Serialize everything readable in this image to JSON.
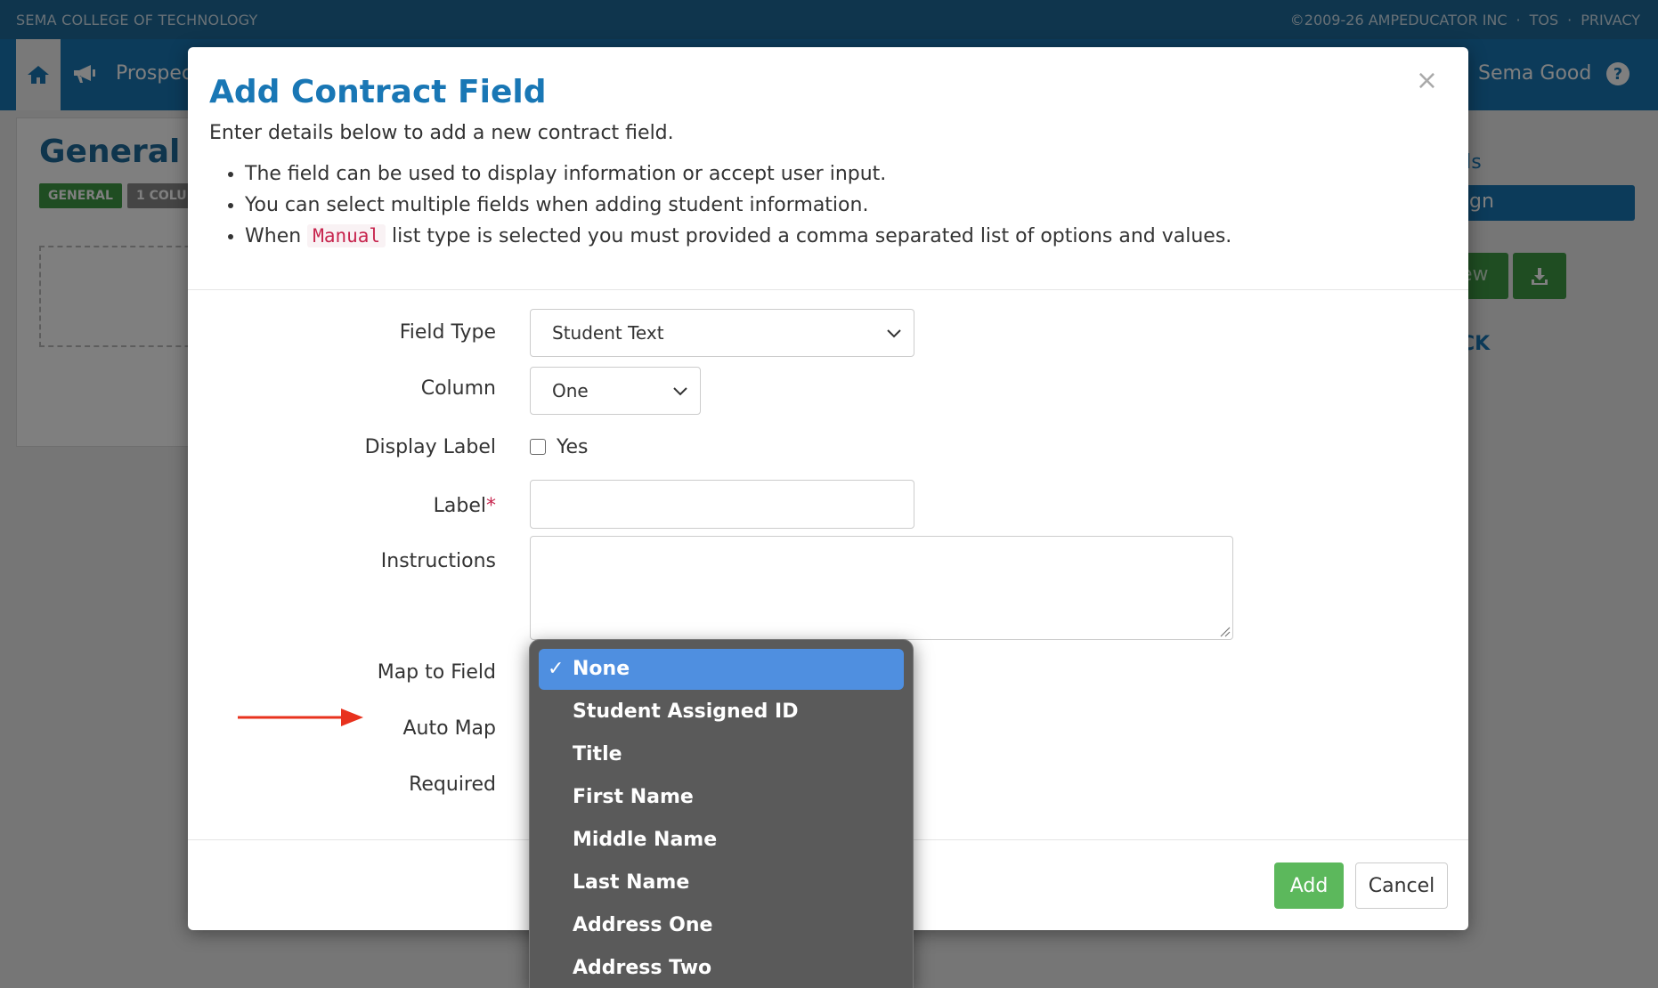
{
  "topbar": {
    "school": "SEMA COLLEGE OF TECHNOLOGY",
    "links": [
      "©2009-26 AMPEDUCATOR INC",
      "·",
      "TOS",
      "·",
      "PRIVACY"
    ]
  },
  "navbar": {
    "prospect": "Prospec",
    "user": "Sema Good"
  },
  "page": {
    "title": "General Se",
    "badge_general": "GENERAL",
    "badge_column": "1 COLU",
    "right_link1": "ils",
    "right_bar": "gn",
    "right_green1": "ew",
    "right_link2": "CK"
  },
  "modal": {
    "title": "Add Contract Field",
    "subtitle": "Enter details below to add a new contract field.",
    "bullets": {
      "b1": "The field can be used to display information or accept user input.",
      "b2": "You can select multiple fields when adding student information.",
      "b3_pre": "When",
      "b3_code": "Manual",
      "b3_post": "list type is selected you must provided a comma separated list of options and values."
    },
    "close_glyph": "×",
    "labels": {
      "field_type": "Field Type",
      "column": "Column",
      "display_label": "Display Label",
      "label": "Label",
      "label_required": "*",
      "instructions": "Instructions",
      "map_to_field": "Map to Field",
      "auto_map": "Auto Map",
      "required": "Required"
    },
    "field_type_value": "Student Text",
    "column_value": "One",
    "display_label_checkbox": "Yes",
    "add_button": "Add",
    "cancel_button": "Cancel"
  },
  "dropdown": {
    "check_glyph": "✓",
    "options": [
      "None",
      "Student Assigned ID",
      "Title",
      "First Name",
      "Middle Name",
      "Last Name",
      "Address One",
      "Address Two"
    ],
    "selected_index": 0
  },
  "colors": {
    "brand_blue": "#1977b5",
    "add_green": "#5cb85c",
    "dropdown_selected": "#4f8fe0",
    "arrow_red": "#e8321e"
  }
}
